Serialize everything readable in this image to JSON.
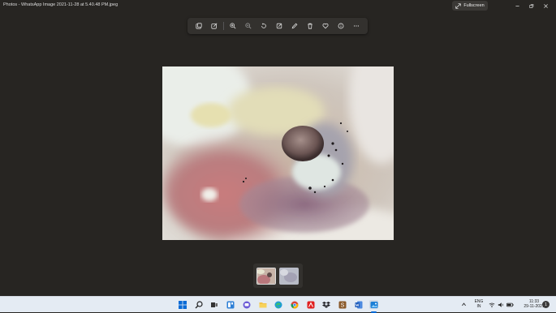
{
  "window": {
    "title": "Photos - WhatsApp Image 2021-11-28 at 5.40.48 PM.jpeg",
    "fullscreen_label": "Fullscreen"
  },
  "toolbar": {
    "icons": [
      "save-copy-icon",
      "edit-icon",
      "zoom-in-icon",
      "zoom-out-icon",
      "rotate-icon",
      "crop-icon",
      "draw-icon",
      "delete-icon",
      "favorite-icon",
      "info-icon",
      "more-icon"
    ]
  },
  "filmstrip": {
    "selected_index": 0,
    "count": 2
  },
  "taskbar": {
    "apps": [
      "start-icon",
      "search-icon",
      "task-view-icon",
      "widgets-icon",
      "chat-icon",
      "file-explorer-icon",
      "edge-icon",
      "chrome-icon",
      "acrobat-icon",
      "dropbox-icon",
      "app-s-icon",
      "word-icon",
      "photos-icon"
    ],
    "language_top": "ENG",
    "language_bottom": "IN",
    "time": "11:33",
    "date": "29-11-2021",
    "notification_count": "1"
  },
  "colors": {
    "background": "#272522",
    "toolbar": "#33312e",
    "taskbar": "#e4ebf3",
    "accent": "#0a6bd6"
  }
}
